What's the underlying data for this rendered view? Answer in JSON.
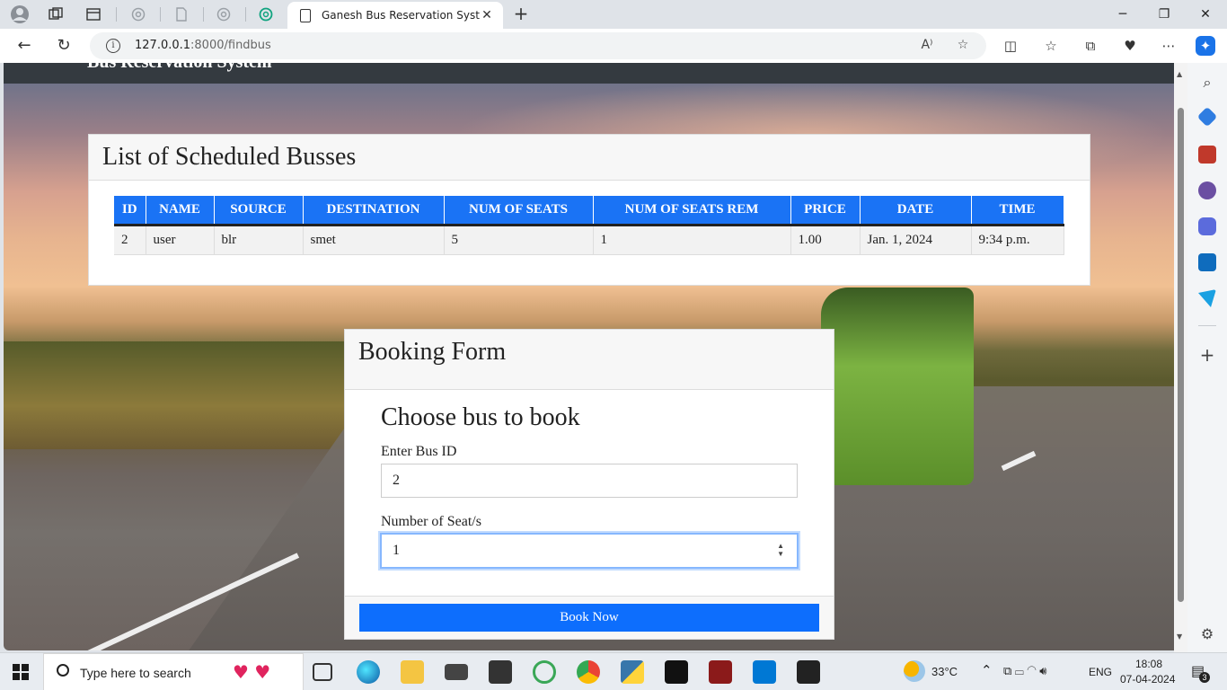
{
  "browser": {
    "active_tab_title": "Ganesh Bus Reservation System",
    "url_host": "127.0.0.1",
    "url_path": ":8000/findbus"
  },
  "page": {
    "nav_brand": "Bus Reservation System",
    "schedule_card": {
      "title": "List of Scheduled Busses",
      "columns": [
        "ID",
        "NAME",
        "SOURCE",
        "DESTINATION",
        "NUM OF SEATS",
        "NUM OF SEATS REM",
        "PRICE",
        "DATE",
        "TIME"
      ],
      "rows": [
        [
          "2",
          "user",
          "blr",
          "smet",
          "5",
          "1",
          "1.00",
          "Jan. 1, 2024",
          "9:34 p.m."
        ]
      ]
    },
    "booking_card": {
      "title": "Booking Form",
      "subtitle": "Choose bus to book",
      "bus_id_label": "Enter Bus ID",
      "bus_id_value": "2",
      "seats_label": "Number of Seat/s",
      "seats_value": "1",
      "submit_label": "Book Now"
    }
  },
  "taskbar": {
    "search_placeholder": "Type here to search",
    "weather": "33°C",
    "language": "ENG",
    "time": "18:08",
    "date": "07-04-2024",
    "notification_count": "3"
  },
  "colors": {
    "primary": "#0d6efd",
    "table_header": "#1a73f5",
    "navbar": "#343a40"
  }
}
